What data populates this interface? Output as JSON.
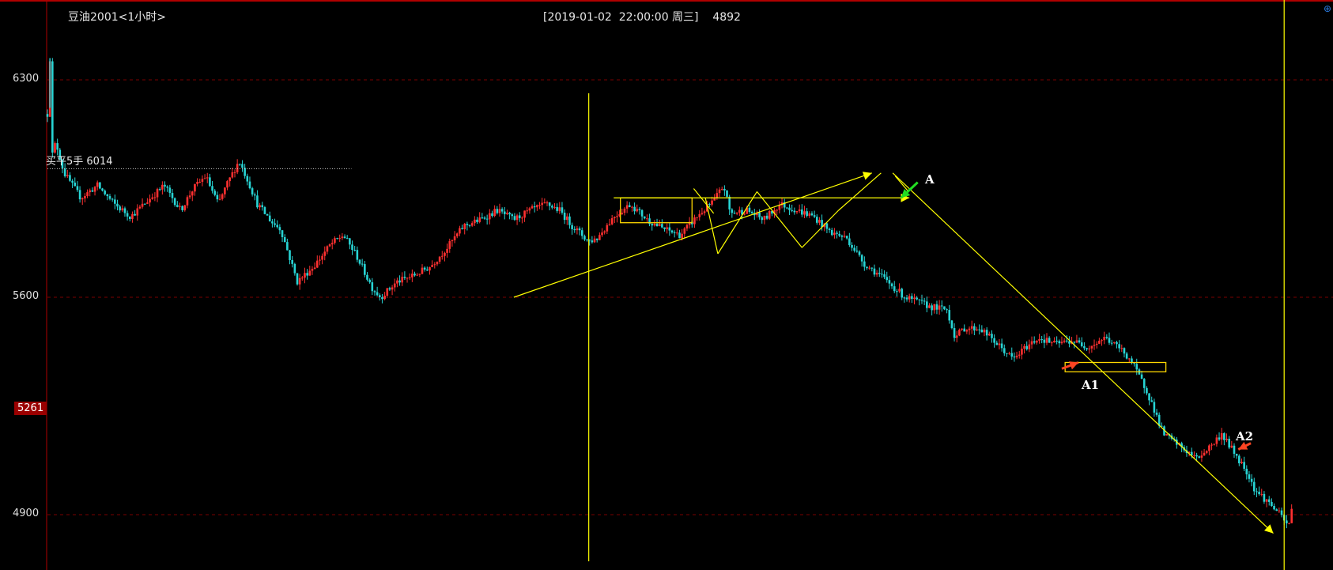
{
  "header": {
    "symbol": "豆油2001<1小时>",
    "cursor_info": "[2019-01-02  22:00:00 周三]    4892"
  },
  "order_marker": {
    "label": "买平5手 6014",
    "price": 6014
  },
  "current_price_badge": "5261",
  "annotations": {
    "a": "A",
    "a1": "A1",
    "a2": "A2"
  },
  "colors": {
    "background": "#000000",
    "up_candle": "#ff3030",
    "down_candle": "#27d4d4",
    "trendline": "#ffff00",
    "zone_box": "#ffd700",
    "arrow_green": "#22dd22",
    "arrow_red": "#ff4422",
    "grid": "#7a0000",
    "badge": "#9a0000"
  },
  "icons": {
    "corner": "crosshair-circle-icon"
  },
  "chart_data": {
    "type": "candlestick",
    "title": "豆油2001<1小时>",
    "y_ticks": [
      6300,
      5600,
      4900
    ],
    "ylim": [
      4730,
      6450
    ],
    "grid": "dashed horizontal at y ticks",
    "path_points": [
      [
        0,
        6190
      ],
      [
        3,
        6370
      ],
      [
        5,
        6050
      ],
      [
        10,
        6100
      ],
      [
        20,
        6000
      ],
      [
        40,
        5920
      ],
      [
        60,
        5960
      ],
      [
        80,
        5900
      ],
      [
        100,
        5860
      ],
      [
        120,
        5910
      ],
      [
        140,
        5960
      ],
      [
        160,
        5880
      ],
      [
        175,
        5950
      ],
      [
        190,
        5990
      ],
      [
        205,
        5900
      ],
      [
        215,
        5960
      ],
      [
        230,
        6040
      ],
      [
        240,
        5980
      ],
      [
        252,
        5900
      ],
      [
        270,
        5840
      ],
      [
        280,
        5820
      ],
      [
        300,
        5650
      ],
      [
        320,
        5700
      ],
      [
        340,
        5770
      ],
      [
        355,
        5800
      ],
      [
        370,
        5740
      ],
      [
        390,
        5630
      ],
      [
        400,
        5600
      ],
      [
        420,
        5650
      ],
      [
        440,
        5670
      ],
      [
        460,
        5700
      ],
      [
        480,
        5760
      ],
      [
        500,
        5830
      ],
      [
        520,
        5850
      ],
      [
        540,
        5880
      ],
      [
        560,
        5850
      ],
      [
        580,
        5880
      ],
      [
        600,
        5900
      ],
      [
        615,
        5880
      ],
      [
        630,
        5830
      ],
      [
        650,
        5780
      ],
      [
        660,
        5790
      ],
      [
        680,
        5860
      ],
      [
        700,
        5900
      ],
      [
        720,
        5850
      ],
      [
        740,
        5820
      ],
      [
        760,
        5800
      ],
      [
        780,
        5860
      ],
      [
        800,
        5910
      ],
      [
        812,
        5960
      ],
      [
        820,
        5870
      ],
      [
        840,
        5880
      ],
      [
        860,
        5850
      ],
      [
        880,
        5900
      ],
      [
        900,
        5880
      ],
      [
        920,
        5860
      ],
      [
        940,
        5810
      ],
      [
        960,
        5790
      ],
      [
        980,
        5710
      ],
      [
        1000,
        5670
      ],
      [
        1030,
        5600
      ],
      [
        1060,
        5570
      ],
      [
        1080,
        5560
      ],
      [
        1090,
        5470
      ],
      [
        1100,
        5500
      ],
      [
        1120,
        5500
      ],
      [
        1140,
        5450
      ],
      [
        1160,
        5400
      ],
      [
        1175,
        5440
      ],
      [
        1190,
        5470
      ],
      [
        1210,
        5450
      ],
      [
        1230,
        5460
      ],
      [
        1250,
        5440
      ],
      [
        1270,
        5470
      ],
      [
        1290,
        5430
      ],
      [
        1300,
        5400
      ],
      [
        1320,
        5300
      ],
      [
        1340,
        5160
      ],
      [
        1360,
        5120
      ],
      [
        1380,
        5080
      ],
      [
        1400,
        5130
      ],
      [
        1410,
        5160
      ],
      [
        1420,
        5120
      ],
      [
        1440,
        5040
      ],
      [
        1450,
        4980
      ],
      [
        1470,
        4930
      ],
      [
        1480,
        4900
      ],
      [
        1490,
        4860
      ],
      [
        1495,
        4930
      ]
    ],
    "price_spikes": [
      {
        "t": 3,
        "p": 6370
      },
      {
        "t": 300,
        "p": 5650
      },
      {
        "t": 1090,
        "p": 5470
      }
    ],
    "order_line": {
      "price": 6014,
      "t_start": 0,
      "t_end": 365
    },
    "vertical_lines": [
      650,
      1485
    ],
    "trendlines": [
      {
        "t1": 560,
        "p1": 5600,
        "t2": 990,
        "p2": 6000
      },
      {
        "t1": 680,
        "p1": 5920,
        "t2": 1035,
        "p2": 5920
      },
      {
        "t1": 1015,
        "p1": 6000,
        "t2": 1472,
        "p2": 4840
      },
      {
        "t1": 790,
        "p1": 5920,
        "t2": 805,
        "p2": 5740
      },
      {
        "t1": 805,
        "p1": 5740,
        "t2": 852,
        "p2": 5940
      },
      {
        "t1": 852,
        "p1": 5940,
        "t2": 906,
        "p2": 5760
      },
      {
        "t1": 906,
        "p1": 5760,
        "t2": 950,
        "p2": 5880
      },
      {
        "t1": 950,
        "p1": 5880,
        "t2": 1001,
        "p2": 6000
      },
      {
        "t1": 776,
        "p1": 5950,
        "t2": 800,
        "p2": 5870
      },
      {
        "t1": 1018,
        "p1": 5990,
        "t2": 1034,
        "p2": 5940
      }
    ],
    "zones": [
      {
        "t1": 688,
        "t2": 774,
        "p1": 5920,
        "p2": 5840
      },
      {
        "t1": 1222,
        "t2": 1343,
        "p1": 5390,
        "p2": 5360
      }
    ],
    "arrows": [
      {
        "label": "A",
        "t_from": 1045,
        "p_from": 5970,
        "t_to": 1025,
        "p_to": 5920,
        "color": "green"
      },
      {
        "label": "A1",
        "t_from": 1218,
        "p_from": 5370,
        "t_to": 1238,
        "p_to": 5390,
        "color": "red"
      },
      {
        "label": "A2",
        "t_from": 1445,
        "p_from": 5130,
        "t_to": 1430,
        "p_to": 5110,
        "color": "red"
      }
    ],
    "t_range": [
      0,
      1500
    ]
  }
}
